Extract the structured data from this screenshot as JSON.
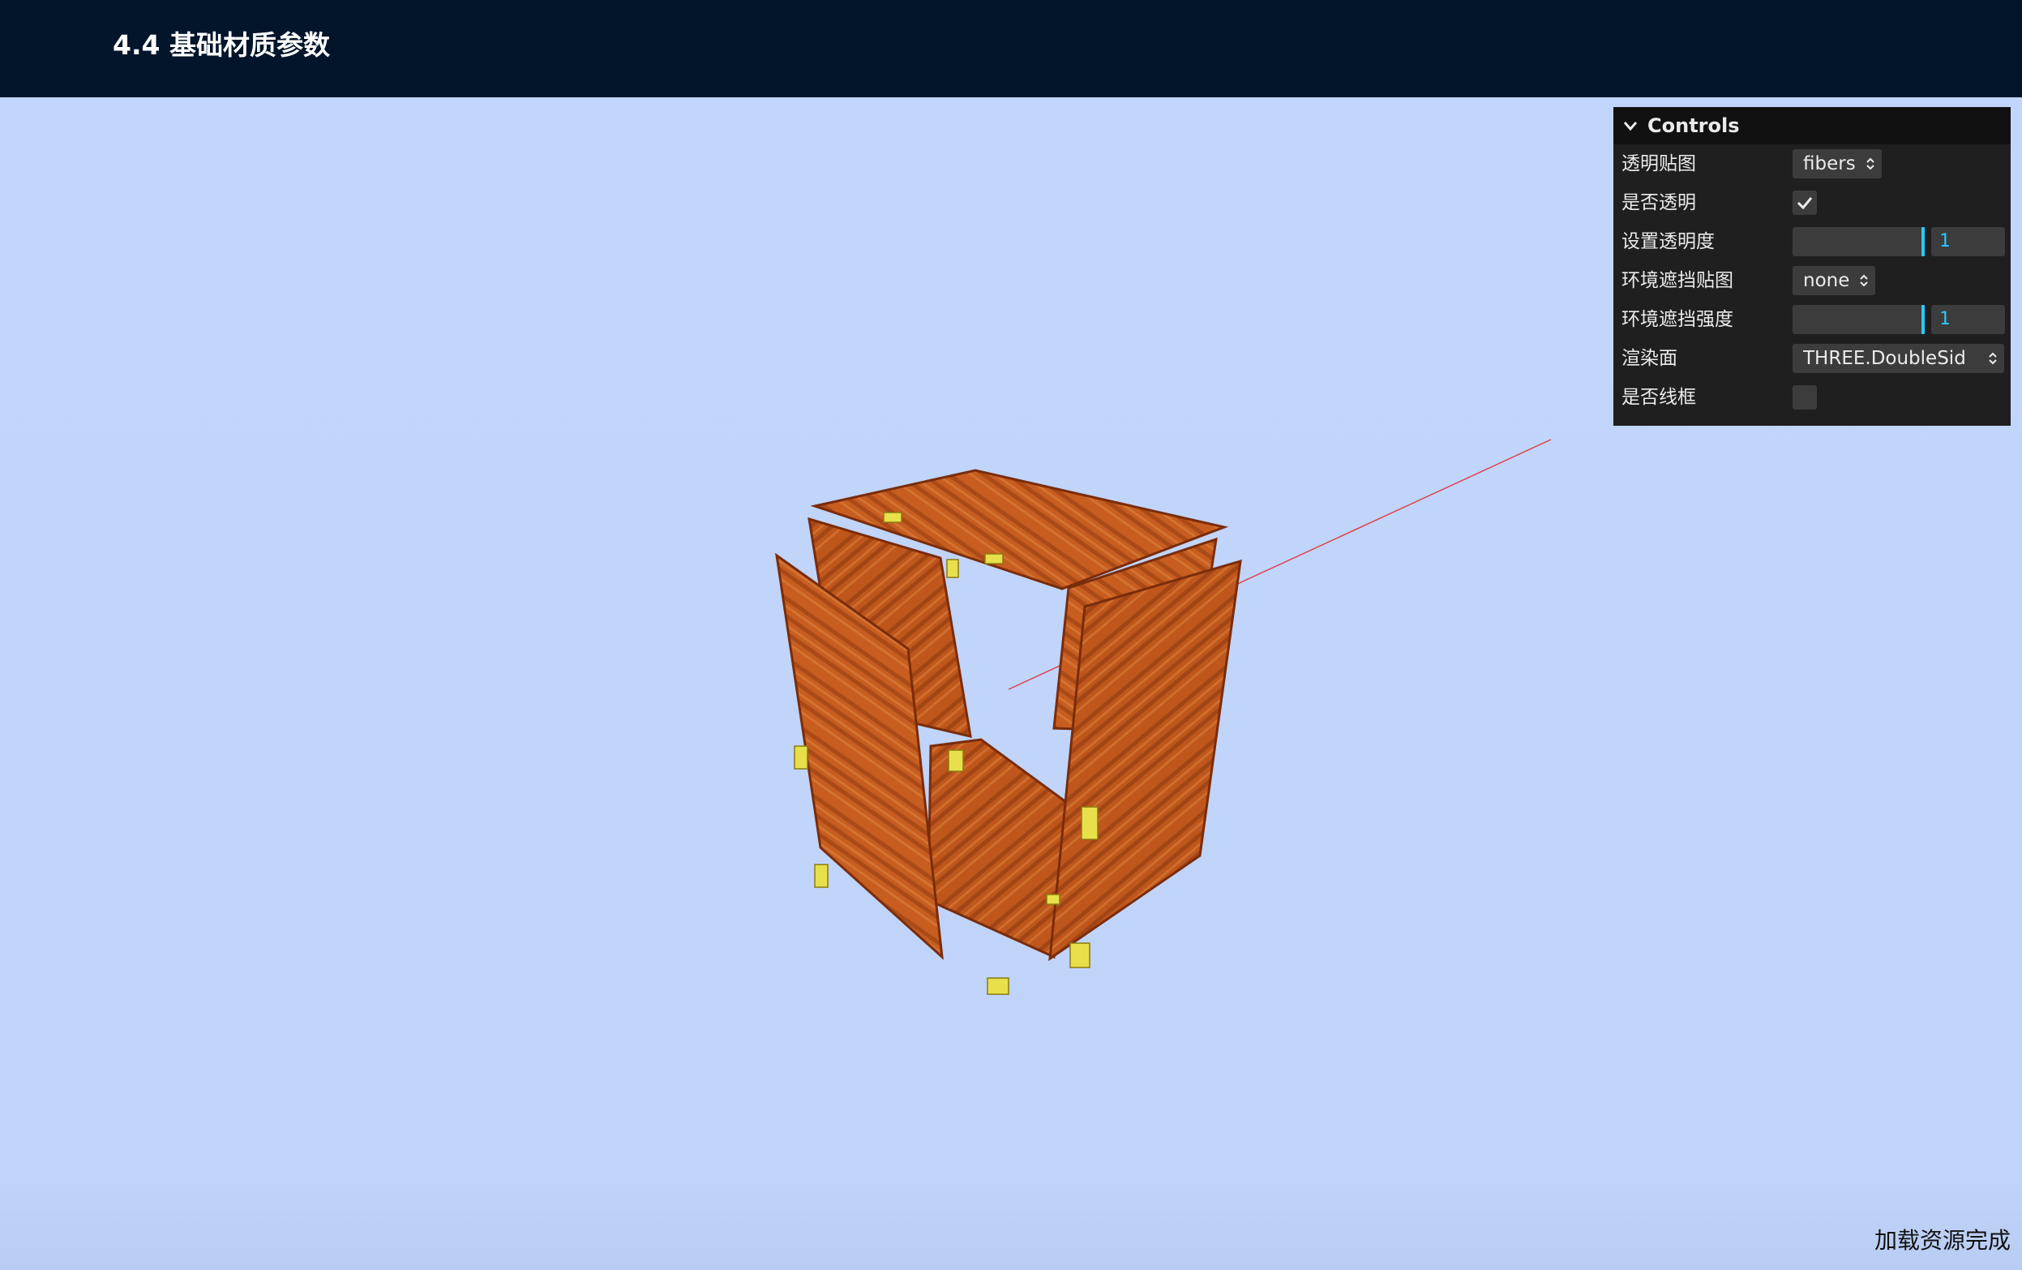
{
  "header": {
    "title": "4.4 基础材质参数"
  },
  "gui": {
    "title": "Controls",
    "rows": [
      {
        "label": "透明贴图",
        "type": "select",
        "value": "fibers"
      },
      {
        "label": "是否透明",
        "type": "checkbox",
        "checked": true
      },
      {
        "label": "设置透明度",
        "type": "slider",
        "value": "1",
        "fraction": 1.0
      },
      {
        "label": "环境遮挡贴图",
        "type": "select",
        "value": "none"
      },
      {
        "label": "环境遮挡强度",
        "type": "slider",
        "value": "1",
        "fraction": 1.0
      },
      {
        "label": "渲染面",
        "type": "select",
        "value": "THREE.DoubleSid"
      },
      {
        "label": "是否线框",
        "type": "checkbox",
        "checked": false
      }
    ]
  },
  "status": {
    "text": "加载资源完成"
  },
  "colors": {
    "header_bg": "#03152b",
    "viewport_bg": "#c0d4fa",
    "gui_bg": "#1f1f1f",
    "gui_accent": "#2cc9ff",
    "wood": "#c45a1c",
    "hinge": "#e8e04a",
    "axis_line": "#e02020"
  }
}
